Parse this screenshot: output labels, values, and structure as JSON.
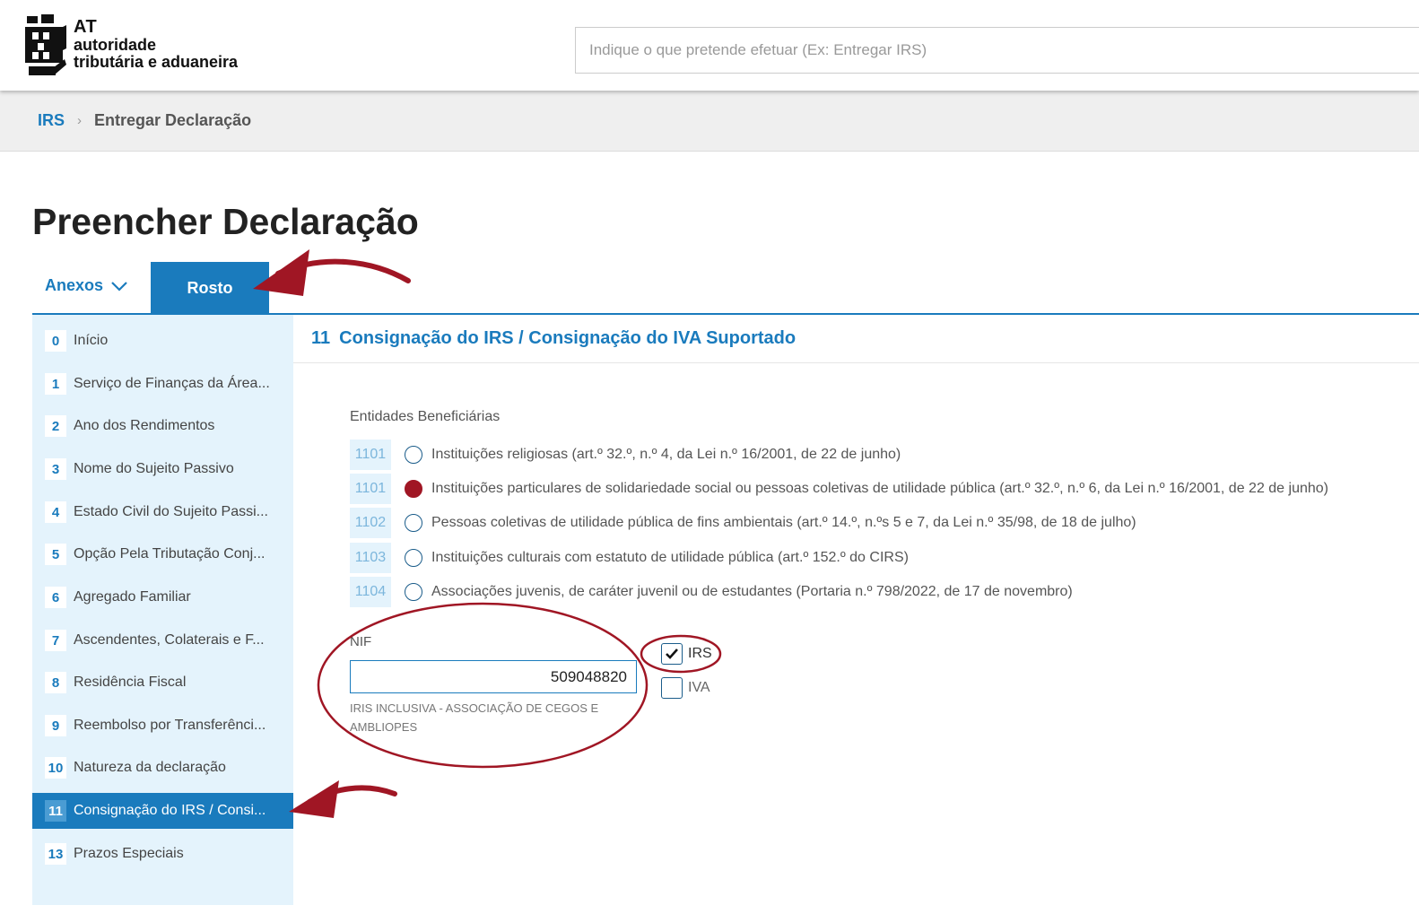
{
  "header": {
    "logo": {
      "abbr": "AT",
      "line1": "autoridade",
      "line2": "tributária e aduaneira"
    },
    "search": {
      "placeholder": "Indique o que pretende efetuar (Ex: Entregar IRS)"
    }
  },
  "breadcrumb": {
    "root": "IRS",
    "separator": "›",
    "current": "Entregar Declaração"
  },
  "page": {
    "title": "Preencher Declaração"
  },
  "tabs": {
    "anexos": "Anexos",
    "rosto": "Rosto"
  },
  "sidebar": {
    "items": [
      {
        "num": "0",
        "label": "Início"
      },
      {
        "num": "1",
        "label": "Serviço de Finanças da Área..."
      },
      {
        "num": "2",
        "label": "Ano dos Rendimentos"
      },
      {
        "num": "3",
        "label": "Nome do Sujeito Passivo"
      },
      {
        "num": "4",
        "label": "Estado Civil do Sujeito Passi..."
      },
      {
        "num": "5",
        "label": "Opção Pela Tributação Conj..."
      },
      {
        "num": "6",
        "label": "Agregado Familiar"
      },
      {
        "num": "7",
        "label": "Ascendentes, Colaterais e F..."
      },
      {
        "num": "8",
        "label": "Residência Fiscal"
      },
      {
        "num": "9",
        "label": "Reembolso por Transferênci..."
      },
      {
        "num": "10",
        "label": "Natureza da declaração"
      },
      {
        "num": "11",
        "label": "Consignação do IRS / Consi..."
      },
      {
        "num": "13",
        "label": "Prazos Especiais"
      }
    ],
    "active_index": 11
  },
  "section": {
    "num": "11",
    "title": "Consignação do IRS / Consignação do IVA Suportado",
    "entidades_label": "Entidades Beneficiárias",
    "options": [
      {
        "code": "1101",
        "text": "Instituições religiosas (art.º 32.º, n.º 4, da Lei n.º 16/2001, de 22 de junho)",
        "checked": false
      },
      {
        "code": "1101",
        "text": "Instituições particulares de solidariedade social ou pessoas coletivas de utilidade pública (art.º 32.º, n.º 6, da Lei n.º 16/2001, de 22 de junho)",
        "checked": true
      },
      {
        "code": "1102",
        "text": "Pessoas coletivas de utilidade pública de fins ambientais (art.º 14.º, n.ºs 5 e 7, da Lei n.º 35/98, de 18 de julho)",
        "checked": false
      },
      {
        "code": "1103",
        "text": "Instituições culturais com estatuto de utilidade pública (art.º 152.º do CIRS)",
        "checked": false
      },
      {
        "code": "1104",
        "text": "Associações juvenis, de caráter juvenil ou de estudantes (Portaria n.º 798/2022, de 17 de novembro)",
        "checked": false
      }
    ],
    "nif": {
      "label": "NIF",
      "value": "509048820",
      "description": "IRIS INCLUSIVA - ASSOCIAÇÃO DE CEGOS E AMBLIOPES"
    },
    "checkboxes": [
      {
        "label": "IRS",
        "checked": true
      },
      {
        "label": "IVA",
        "checked": false
      }
    ]
  },
  "colors": {
    "primary": "#1a7bbd",
    "sidebar_bg": "#e4f3fc",
    "annotation": "#a01624"
  }
}
